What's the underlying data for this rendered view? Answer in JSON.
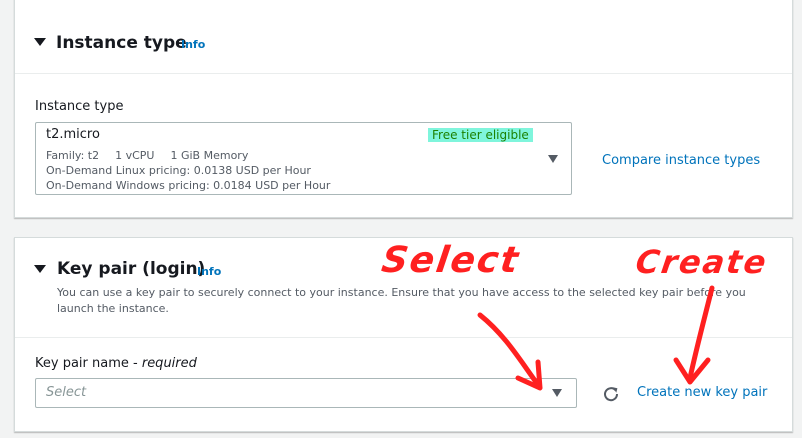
{
  "instance_type_panel": {
    "title": "Instance type",
    "info": "Info",
    "field_label": "Instance type",
    "selected": {
      "name": "t2.micro",
      "badge": "Free tier eligible",
      "family": "Family: t2",
      "vcpu": "1 vCPU",
      "memory": "1 GiB Memory",
      "linux_pricing": "On-Demand Linux pricing: 0.0138 USD per Hour",
      "windows_pricing": "On-Demand Windows pricing: 0.0184 USD per Hour"
    },
    "compare_link": "Compare instance types"
  },
  "key_pair_panel": {
    "title": "Key pair (login)",
    "info": "Info",
    "description": "You can use a key pair to securely connect to your instance. Ensure that you have access to the selected key pair before you launch the instance.",
    "field_label": "Key pair name - ",
    "field_required": "required",
    "select_placeholder": "Select",
    "create_link": "Create new key pair"
  },
  "annotations": {
    "select_note": "Select",
    "create_note": "Create"
  },
  "colors": {
    "link": "#0073bb",
    "badge_bg": "#7ff5dc",
    "badge_text": "#1d8102",
    "annotation": "#ff2020"
  },
  "icons": [
    "caret-down-icon",
    "refresh-icon",
    "dropdown-arrow-icon"
  ]
}
